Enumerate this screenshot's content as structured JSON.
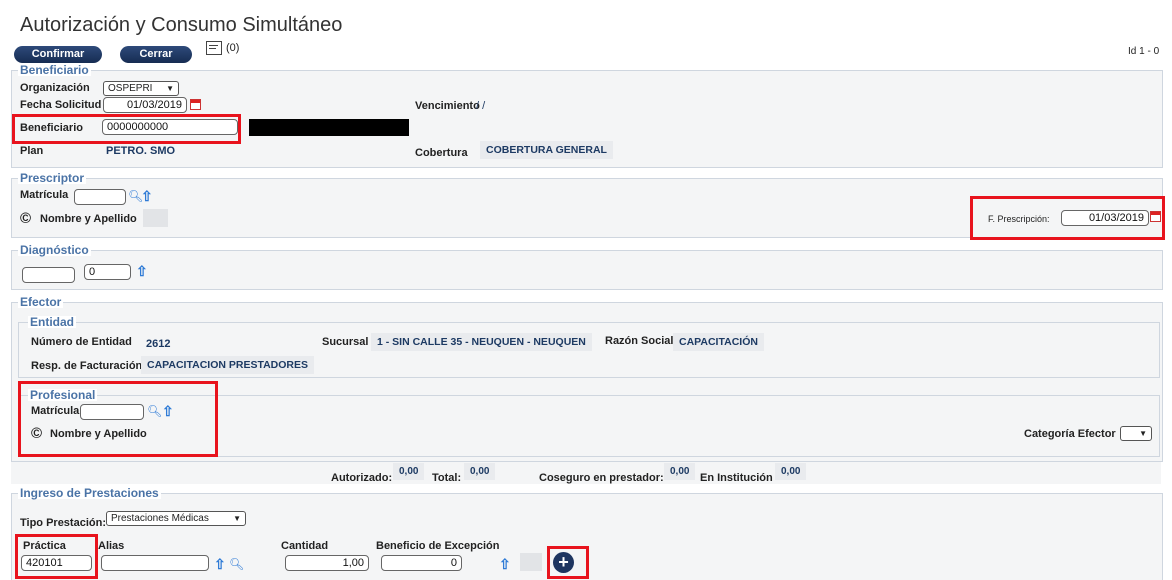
{
  "header": {
    "title": "Autorización y Consumo Simultáneo",
    "confirm_label": "Confirmar",
    "close_label": "Cerrar",
    "notes_count": "(0)",
    "id_label": "Id 1 - 0"
  },
  "beneficiario": {
    "legend": "Beneficiario",
    "org_label": "Organización",
    "org_value": "OSPEPRI",
    "fecha_label": "Fecha Solicitud",
    "fecha_value": "01/03/2019",
    "venc_label": "Vencimiento",
    "venc_value": "/ /",
    "benef_label": "Beneficiario",
    "benef_value": "0000000000",
    "plan_label": "Plan",
    "plan_value": "PETRO. SMO",
    "cobertura_label": "Cobertura",
    "cobertura_value": "COBERTURA GENERAL"
  },
  "prescriptor": {
    "legend": "Prescriptor",
    "matricula_label": "Matrícula",
    "nombre_label": "Nombre y Apellido",
    "fprescripcion_label": "F. Prescripción:",
    "fprescripcion_value": "01/03/2019"
  },
  "diagnostico": {
    "legend": "Diagnóstico",
    "code_value": "0"
  },
  "efector": {
    "legend": "Efector",
    "entidad_legend": "Entidad",
    "num_entidad_label": "Número de Entidad",
    "num_entidad_value": "2612",
    "sucursal_label": "Sucursal",
    "sucursal_value": "1 - SIN CALLE 35 - NEUQUEN - NEUQUEN",
    "razon_label": "Razón Social",
    "razon_value": "CAPACITACIÓN",
    "resp_label": "Resp. de Facturación",
    "resp_value": "CAPACITACION PRESTADORES",
    "profesional_legend": "Profesional",
    "matricula_label": "Matrícula",
    "nombre_label": "Nombre y Apellido",
    "categoria_label": "Categoría Efector"
  },
  "totales": {
    "autorizado_label": "Autorizado:",
    "autorizado_value": "0,00",
    "total_label": "Total:",
    "total_value": "0,00",
    "coseguro_label": "Coseguro en prestador:",
    "coseguro_value": "0,00",
    "institucion_label": "En Institución",
    "institucion_value": "0,00"
  },
  "prestaciones": {
    "legend": "Ingreso de Prestaciones",
    "tipo_label": "Tipo Prestación:",
    "tipo_value": "Prestaciones Médicas",
    "practica_label": "Práctica",
    "practica_value": "420101",
    "alias_label": "Alias",
    "cantidad_label": "Cantidad",
    "cantidad_value": "1,00",
    "beneficio_label": "Beneficio de Excepción",
    "beneficio_value": "0"
  },
  "icons": [
    "edit-notes-icon",
    "calendar-icon",
    "search-icon",
    "arrow-up-icon",
    "copyright-icon",
    "add-circle-icon"
  ],
  "colors": {
    "highlight": "#e8131d",
    "legend": "#4a73a6",
    "button": "#1e3560"
  }
}
